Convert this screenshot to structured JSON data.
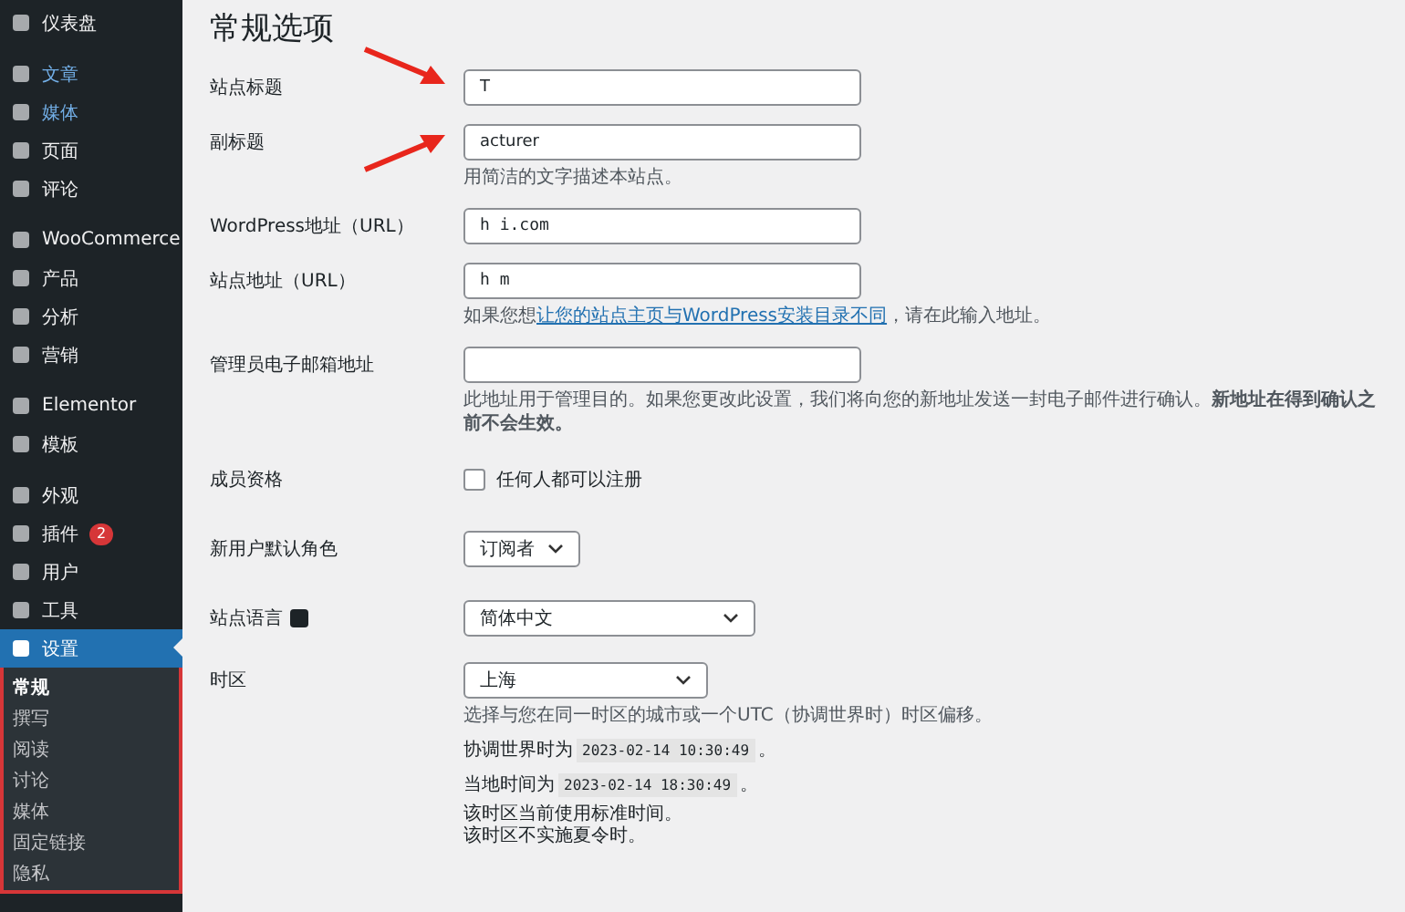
{
  "sidebar": {
    "groups": [
      {
        "items": [
          {
            "label": "仪表盘",
            "highlighted": false,
            "selected": false
          }
        ]
      },
      {
        "items": [
          {
            "label": "文章",
            "highlighted": true,
            "selected": false
          },
          {
            "label": "媒体",
            "highlighted": true,
            "selected": false
          },
          {
            "label": "页面",
            "highlighted": false,
            "selected": false
          },
          {
            "label": "评论",
            "highlighted": false,
            "selected": false
          }
        ]
      },
      {
        "items": [
          {
            "label": "WooCommerce",
            "highlighted": false,
            "selected": false
          },
          {
            "label": "产品",
            "highlighted": false,
            "selected": false
          },
          {
            "label": "分析",
            "highlighted": false,
            "selected": false
          },
          {
            "label": "营销",
            "highlighted": false,
            "selected": false
          }
        ]
      },
      {
        "items": [
          {
            "label": "Elementor",
            "highlighted": false,
            "selected": false
          },
          {
            "label": "模板",
            "highlighted": false,
            "selected": false
          }
        ]
      },
      {
        "items": [
          {
            "label": "外观",
            "highlighted": false,
            "selected": false
          },
          {
            "label": "插件",
            "badge": "2",
            "highlighted": false,
            "selected": false
          },
          {
            "label": "用户",
            "highlighted": false,
            "selected": false
          },
          {
            "label": "工具",
            "highlighted": false,
            "selected": false
          },
          {
            "label": "设置",
            "highlighted": false,
            "selected": true,
            "annotated": true,
            "children": [
              {
                "label": "常规",
                "selected": true
              },
              {
                "label": "撰写",
                "selected": false
              },
              {
                "label": "阅读",
                "selected": false
              },
              {
                "label": "讨论",
                "selected": false
              },
              {
                "label": "媒体",
                "selected": false
              },
              {
                "label": "固定链接",
                "selected": false
              },
              {
                "label": "隐私",
                "selected": false
              }
            ]
          }
        ]
      }
    ]
  },
  "page": {
    "title": "常规选项",
    "rows": [
      {
        "kind": "text",
        "label": "站点标题",
        "value": "T",
        "arrow": true
      },
      {
        "kind": "text",
        "label": "副标题",
        "value": "acturer",
        "arrow": true,
        "hint": "用简洁的文字描述本站点。"
      },
      {
        "kind": "text",
        "label": "WordPress地址（URL）",
        "value": "h i.com",
        "mono": true
      },
      {
        "kind": "text",
        "label": "站点地址（URL）",
        "value": "h m",
        "mono": true,
        "hint_before": "如果您想",
        "hint_link": "让您的站点主页与WordPress安装目录不同",
        "hint_after": "，请在此输入地址。"
      },
      {
        "kind": "text",
        "label": "管理员电子邮箱地址",
        "value": "",
        "hint": "此地址用于管理目的。如果您更改此设置，我们将向您的新地址发送一封电子邮件进行确认。**新地址在得到确认之前不会生效。**"
      },
      {
        "kind": "checkbox",
        "label": "成员资格",
        "option": "任何人都可以注册",
        "checked": false
      },
      {
        "kind": "select",
        "label": "新用户默认角色",
        "value": "订阅者"
      },
      {
        "kind": "language",
        "label": "站点语言",
        "value": "简体中文"
      },
      {
        "kind": "timezone",
        "label": "时区",
        "value": "上海",
        "hint": "选择与您在同一时区的城市或一个UTC（协调世界时）时区偏移。",
        "times": [
          {
            "prefix": "协调世界时为",
            "time": "2023-02-14 10:30:49",
            "suffix": "。"
          },
          {
            "prefix": "当地时间为",
            "time": "2023-02-14 18:30:49",
            "suffix": "。"
          }
        ],
        "notes": [
          "该时区当前使用标准时间。",
          "该时区不实施夏令时。"
        ]
      }
    ]
  }
}
